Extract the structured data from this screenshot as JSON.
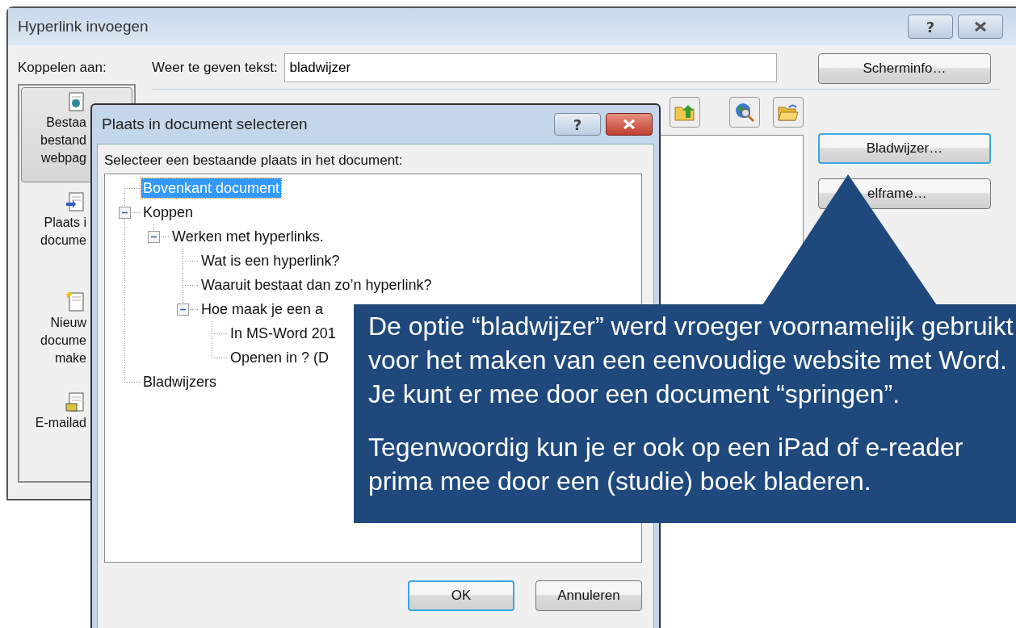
{
  "window": {
    "title": "Hyperlink invoegen",
    "help_button": "?"
  },
  "link_to": {
    "label": "Koppelen aan:",
    "items": [
      {
        "kind": "existing",
        "lines": [
          "Bestaa",
          "bestand",
          "webpag"
        ],
        "selected": true
      },
      {
        "kind": "place",
        "lines": [
          "Plaats i",
          "docume"
        ],
        "selected": false
      },
      {
        "kind": "new",
        "lines": [
          "Nieuw",
          "docume",
          "make"
        ],
        "selected": false
      },
      {
        "kind": "email",
        "lines": [
          "E-mailad"
        ],
        "selected": false
      }
    ]
  },
  "display_text": {
    "label": "Weer te geven tekst:",
    "value": "bladwijzer"
  },
  "buttons": [
    {
      "label": "Scherminfo…",
      "focused": false
    },
    {
      "label": "Bladwijzer…",
      "focused": true
    },
    {
      "label": "elframe…",
      "focused": false
    }
  ],
  "dialog": {
    "title": "Plaats in document selecteren",
    "help_button": "?",
    "prompt": "Selecteer een bestaande plaats in het document:",
    "tree": [
      {
        "label": "Bovenkant document",
        "selected": true
      },
      {
        "label": "Koppen",
        "selected": false,
        "expanded": true,
        "children": [
          {
            "label": "Werken met hyperlinks.",
            "selected": false,
            "expanded": true,
            "children": [
              {
                "label": "Wat is een hyperlink?",
                "selected": false
              },
              {
                "label": "Waaruit bestaat dan zo’n hyperlink?",
                "selected": false
              },
              {
                "label": "Hoe maak je een a",
                "selected": false,
                "expanded": true,
                "children": [
                  {
                    "label": "In MS-Word 201",
                    "selected": false
                  },
                  {
                    "label": "Openen in ? (D",
                    "selected": false
                  }
                ]
              }
            ]
          }
        ]
      },
      {
        "label": "Bladwijzers",
        "selected": false
      }
    ],
    "buttons": [
      {
        "label": "OK",
        "default": true
      },
      {
        "label": "Annuleren",
        "default": false
      }
    ]
  },
  "callout": {
    "paragraphs": [
      "De optie “bladwijzer” werd vroeger voornamelijk gebruikt voor het maken van een eenvoudige website met Word. Je kunt er mee door een document “springen”.",
      "Tegenwoordig kun je er ook op een iPad of e-reader prima mee door een (studie) boek bladeren."
    ]
  }
}
